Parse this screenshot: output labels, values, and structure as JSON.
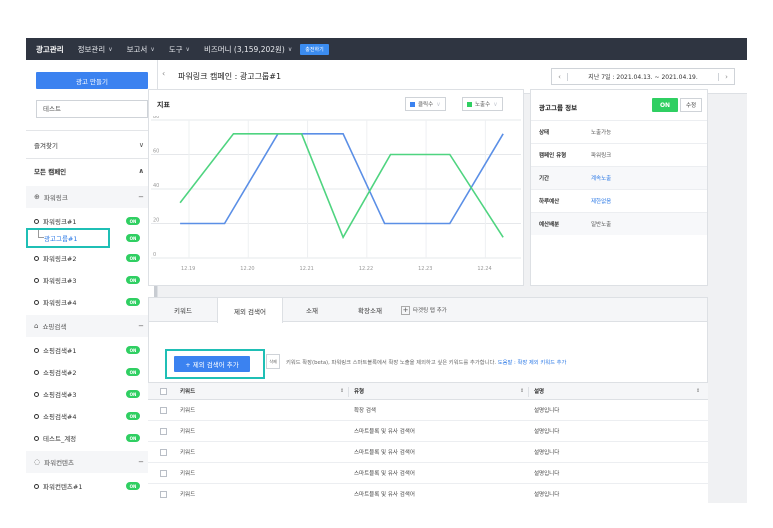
{
  "nav": {
    "items": [
      {
        "label": "광고관리",
        "chevron": false
      },
      {
        "label": "정보관리",
        "chevron": true
      },
      {
        "label": "보고서",
        "chevron": true
      },
      {
        "label": "도구",
        "chevron": true
      },
      {
        "label": "비즈머니 (3,159,202원)",
        "chevron": true
      }
    ],
    "charge_label": "충전하기"
  },
  "sidebar": {
    "create_button": "광고 만들기",
    "search_value": "테스트",
    "favorites": {
      "label": "즐겨찾기",
      "icon": "chevron-down-icon"
    },
    "all_campaigns": {
      "label": "모든 캠페인",
      "icon": "chevron-up-icon"
    },
    "groups": [
      {
        "label": "파워링크",
        "icon": "globe-icon",
        "toggle": "−"
      },
      {
        "label": "쇼핑검색",
        "icon": "bag-icon",
        "toggle": "−"
      },
      {
        "label": "파워컨텐츠",
        "icon": "chat-icon",
        "toggle": "−"
      }
    ],
    "power_items": [
      "파워링크#1",
      "파워링크#2",
      "파워링크#3",
      "파워링크#4"
    ],
    "selected_item": "광고그룹#1",
    "shopping_items": [
      "쇼핑검색#1",
      "쇼핑검색#2",
      "쇼핑검색#3",
      "쇼핑검색#4",
      "테스트_계정"
    ],
    "content_items": [
      "파워컨텐츠#1"
    ],
    "badge": "ON"
  },
  "header": {
    "title": "파워링크 캠페인 : 광고그룹#1",
    "date_range": "지난 7일 : 2021.04.13. ~ 2021.04.19."
  },
  "chart_panel": {
    "title": "지표",
    "metric1": "클릭수",
    "metric2": "노출수"
  },
  "chart_data": {
    "type": "line",
    "categories": [
      "12.19",
      "12.20",
      "12.21",
      "12.22",
      "12.23",
      "12.24"
    ],
    "ylim": [
      0,
      80
    ],
    "yticks": [
      0,
      20,
      40,
      60,
      80
    ],
    "grid": true,
    "series": [
      {
        "name": "클릭수",
        "color": "#5b8fe6",
        "points": [
          [
            -0.15,
            20
          ],
          [
            0.6,
            20
          ],
          [
            1.5,
            72
          ],
          [
            2.6,
            72
          ],
          [
            3.3,
            20
          ],
          [
            4.4,
            20
          ],
          [
            5.3,
            72
          ]
        ]
      },
      {
        "name": "노출수",
        "color": "#4fd480",
        "points": [
          [
            -0.15,
            32
          ],
          [
            0.75,
            72
          ],
          [
            1.9,
            72
          ],
          [
            2.6,
            12
          ],
          [
            3.4,
            60
          ],
          [
            4.4,
            60
          ],
          [
            5.3,
            12
          ]
        ]
      }
    ]
  },
  "info_panel": {
    "title": "광고그룹 정보",
    "toggle": "ON",
    "edit": "수정",
    "rows": [
      {
        "k": "상태",
        "v": "노출가능",
        "link": false
      },
      {
        "k": "캠페인 유형",
        "v": "파워링크",
        "link": false
      },
      {
        "k": "기간",
        "v": "계속노출",
        "link": true
      },
      {
        "k": "하루예산",
        "v": "제한없음",
        "link": true
      },
      {
        "k": "예산배분",
        "v": "일반노출",
        "link": false
      }
    ]
  },
  "tabs": {
    "items": [
      "키워드",
      "제외 검색어",
      "소재",
      "확장소재"
    ],
    "active": 1,
    "add_label": "타겟팅 탭 추가"
  },
  "keyword_actions": {
    "add_button": "+ 제외 검색어 추가",
    "delete_button": "삭제",
    "help_text": "키워드 확장(beta), 파워링크 스마트블록에서 확장 노출을 제외하고 싶은 키워드를 추가합니다.",
    "help_link": "도움말 : 확장 제외 키워드 추가"
  },
  "table": {
    "headers": [
      "키워드",
      "유형",
      "설명"
    ],
    "rows": [
      [
        "키워드",
        "확장 검색",
        "설명입니다"
      ],
      [
        "키워드",
        "스마트블록 및 유사 검색어",
        "설명입니다"
      ],
      [
        "키워드",
        "스마트블록 및 유사 검색어",
        "설명입니다"
      ],
      [
        "키워드",
        "스마트블록 및 유사 검색어",
        "설명입니다"
      ],
      [
        "키워드",
        "스마트블록 및 유사 검색어",
        "설명입니다"
      ]
    ]
  }
}
